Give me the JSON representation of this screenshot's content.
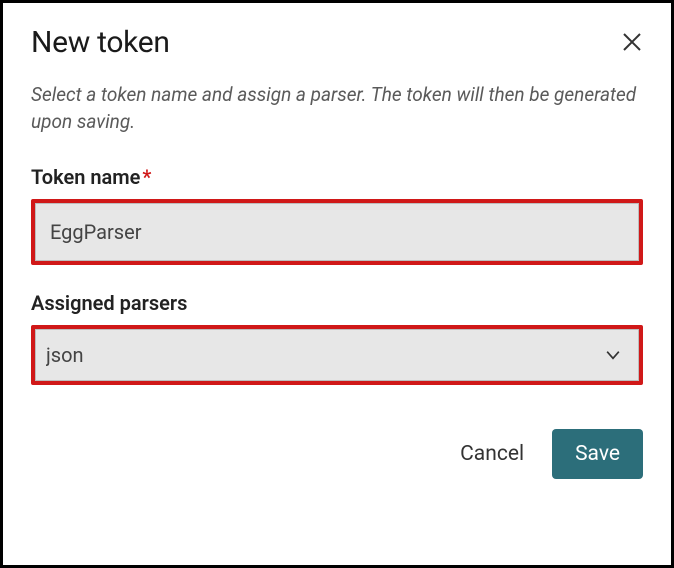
{
  "dialog": {
    "title": "New token",
    "description": "Select a token name and assign a parser. The token will then be generated upon saving.",
    "close_icon_label": "close"
  },
  "fields": {
    "token_name": {
      "label": "Token name",
      "required": true,
      "value": "EggParser"
    },
    "assigned_parsers": {
      "label": "Assigned parsers",
      "value": "json"
    }
  },
  "buttons": {
    "cancel": "Cancel",
    "save": "Save"
  }
}
